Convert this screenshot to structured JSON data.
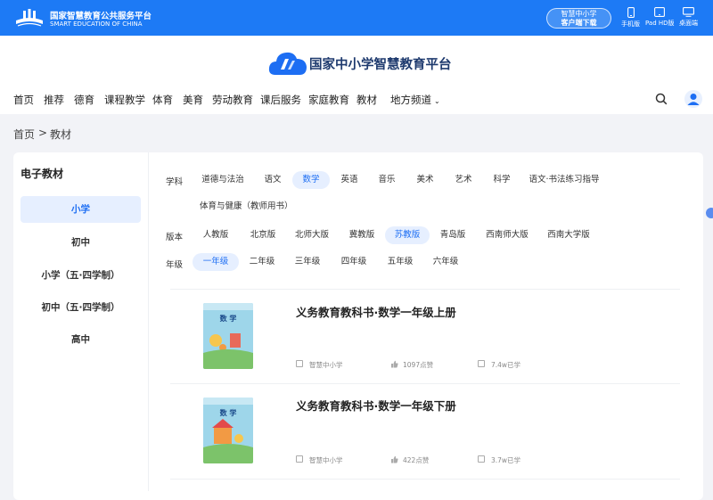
{
  "topbar": {
    "brand_cn": "国家智慧教育公共服务平台",
    "brand_en": "SMART EDUCATION OF CHINA",
    "download_line1": "智慧中小学",
    "download_line2": "客户端下载",
    "devices": [
      "手机版",
      "Pad HD版",
      "桌面端"
    ]
  },
  "header": {
    "site_title": "国家中小学智慧教育平台"
  },
  "nav": [
    "首页",
    "推荐",
    "德育",
    "课程教学",
    "体育",
    "美育",
    "劳动教育",
    "课后服务",
    "家庭教育",
    "教材",
    "地方频道"
  ],
  "breadcrumb": {
    "home": "首页",
    "sep": ">",
    "current": "教材"
  },
  "sidebar": {
    "title": "电子教材",
    "items": [
      "小学",
      "初中",
      "小学（五·四学制）",
      "初中（五·四学制）",
      "高中"
    ],
    "active": "小学"
  },
  "filters": {
    "subject": {
      "label": "学科",
      "options": [
        "道德与法治",
        "语文",
        "数学",
        "英语",
        "音乐",
        "美术",
        "艺术",
        "科学",
        "语文·书法练习指导",
        "体育与健康（教师用书）"
      ],
      "selected": "数学"
    },
    "edition": {
      "label": "版本",
      "options": [
        "人教版",
        "北京版",
        "北师大版",
        "冀教版",
        "苏教版",
        "青岛版",
        "西南师大版",
        "西南大学版"
      ],
      "selected": "苏教版"
    },
    "grade": {
      "label": "年级",
      "options": [
        "一年级",
        "二年级",
        "三年级",
        "四年级",
        "五年级",
        "六年级"
      ],
      "selected": "一年级"
    }
  },
  "books": [
    {
      "title": "义务教育教科书·数学一年级上册",
      "cover_text": "数 学",
      "publisher": "智慧中小学",
      "likes": "1097点赞",
      "learned": "7.4w已学"
    },
    {
      "title": "义务教育教科书·数学一年级下册",
      "cover_text": "数 学",
      "publisher": "智慧中小学",
      "likes": "422点赞",
      "learned": "3.7w已学"
    }
  ],
  "colors": {
    "primary": "#1d7af5",
    "active_text": "#1d6ef3",
    "active_bg": "#e6efff",
    "page_bg": "#f2f3f7"
  }
}
